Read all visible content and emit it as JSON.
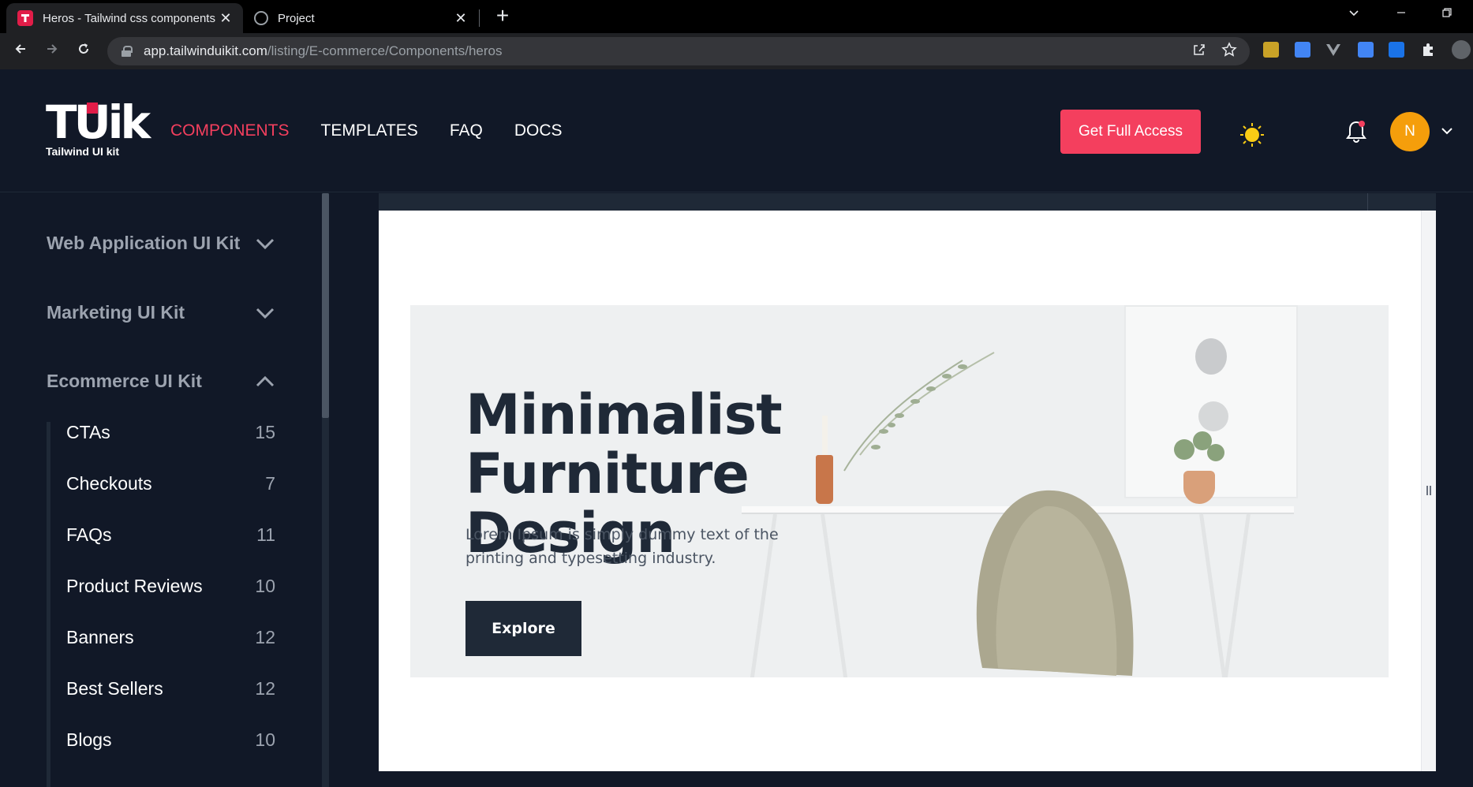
{
  "browser": {
    "tabs": [
      {
        "title": "Heros - Tailwind css components",
        "active": true
      },
      {
        "title": "Project",
        "active": false
      }
    ],
    "url": {
      "host": "app.tailwinduikit.com",
      "path": "/listing/E-commerce/Components/heros"
    }
  },
  "header": {
    "logo": {
      "mark": "TUik",
      "subtitle": "Tailwind UI kit"
    },
    "nav": [
      {
        "label": "COMPONENTS",
        "active": true
      },
      {
        "label": "TEMPLATES",
        "active": false
      },
      {
        "label": "FAQ",
        "active": false
      },
      {
        "label": "DOCS",
        "active": false
      }
    ],
    "cta_label": "Get Full Access",
    "avatar_initial": "N",
    "accent_color": "#f43f5e"
  },
  "sidebar": {
    "sections": [
      {
        "label": "Web Application UI Kit",
        "expanded": false
      },
      {
        "label": "Marketing UI Kit",
        "expanded": false
      },
      {
        "label": "Ecommerce UI Kit",
        "expanded": true
      }
    ],
    "items": [
      {
        "label": "CTAs",
        "count": "15"
      },
      {
        "label": "Checkouts",
        "count": "7"
      },
      {
        "label": "FAQs",
        "count": "11"
      },
      {
        "label": "Product Reviews",
        "count": "10"
      },
      {
        "label": "Banners",
        "count": "12"
      },
      {
        "label": "Best Sellers",
        "count": "12"
      },
      {
        "label": "Blogs",
        "count": "10"
      }
    ]
  },
  "preview": {
    "hero": {
      "title_line1": "Minimalist",
      "title_line2": "Furniture Design",
      "text": "Lorem Ipsum is simply dummy text of the printing and typesetting industry.",
      "button_label": "Explore"
    }
  }
}
